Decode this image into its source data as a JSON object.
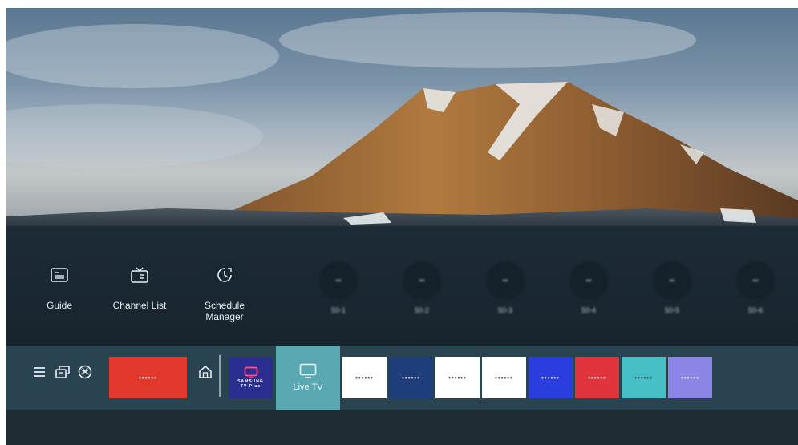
{
  "quick_actions": [
    {
      "label": "Guide",
      "icon": "guide-icon"
    },
    {
      "label": "Channel List",
      "icon": "channel-list-icon"
    },
    {
      "label": "Schedule\nManager",
      "icon": "clock-icon"
    }
  ],
  "channels": [
    {
      "label": "50-1"
    },
    {
      "label": "50-2"
    },
    {
      "label": "50-3"
    },
    {
      "label": "50-4"
    },
    {
      "label": "50-5"
    },
    {
      "label": "50-6"
    }
  ],
  "nav_icons": [
    "menu-icon",
    "source-icon",
    "ambient-icon"
  ],
  "featured_tile": {
    "text": "••••••",
    "color": "#e2372b"
  },
  "tv_plus": {
    "line1": "SAMSUNG",
    "line2": "TV Plus",
    "color": "#2a2f8f"
  },
  "live_tv": {
    "label": "Live TV",
    "color": "#58a7b1"
  },
  "app_tiles": [
    {
      "text": "••••••",
      "color": "#ffffff",
      "text_color": "#1a1a1a"
    },
    {
      "text": "••••••",
      "color": "#1d3e7a",
      "text_color": "#ffffff"
    },
    {
      "text": "••••••",
      "color": "#ffffff",
      "text_color": "#1a1a1a"
    },
    {
      "text": "••••••",
      "color": "#ffffff",
      "text_color": "#1a1a1a"
    },
    {
      "text": "••••••",
      "color": "#2a3ee0",
      "text_color": "#ffffff"
    },
    {
      "text": "••••••",
      "color": "#e0333b",
      "text_color": "#ffffff"
    },
    {
      "text": "••••••",
      "color": "#47bfc7",
      "text_color": "#1a3a40"
    },
    {
      "text": "••••••",
      "color": "#8a86e6",
      "text_color": "#ffffff"
    }
  ]
}
